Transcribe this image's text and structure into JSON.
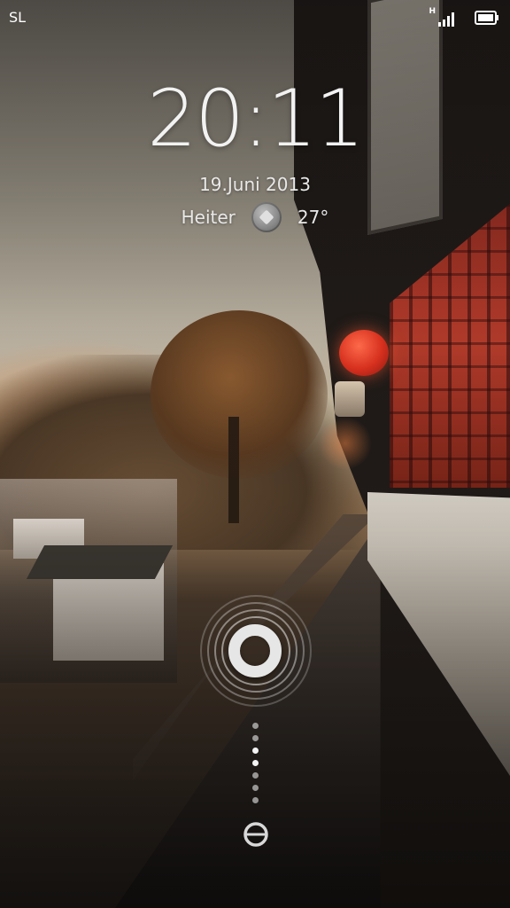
{
  "status_bar": {
    "carrier": "SL",
    "network_type": "H",
    "signal_icon": "signal-bars-icon",
    "battery_icon": "battery-icon"
  },
  "lock_screen": {
    "time": "20:11",
    "date": "19.Juni 2013",
    "weather": {
      "condition": "Heiter",
      "icon": "weather-icon",
      "temperature": "27°"
    },
    "unlock": {
      "knob_icon": "unlock-ring-icon",
      "guide_icon": "slide-dots-icon",
      "bottom_icon": "miui-icon"
    }
  },
  "colors": {
    "text": "#f2f2f2",
    "lantern_red": "#d8301e",
    "wall_red": "#b03a2a"
  }
}
